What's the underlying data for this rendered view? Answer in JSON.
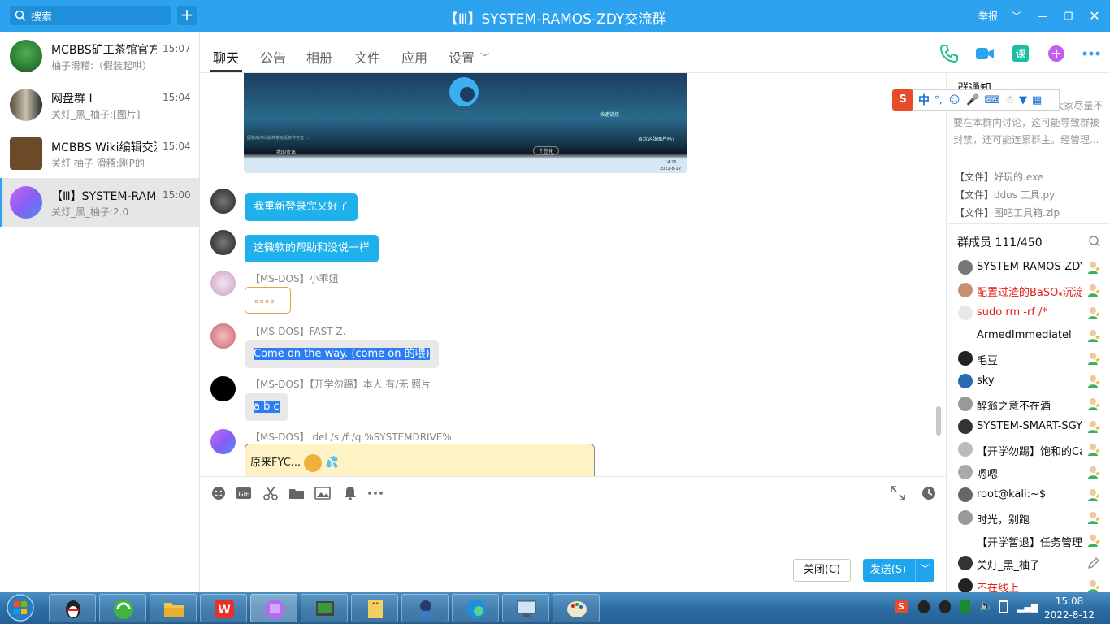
{
  "titlebar": {
    "search_label": "搜索",
    "title": "【Ⅲ】SYSTEM-RAMOS-ZDY交流群",
    "report": "举报"
  },
  "conversations": [
    {
      "name": "MCBBS矿工茶馆官方",
      "time": "15:07",
      "preview": "柚子滑稽:（假装起哄）"
    },
    {
      "name": "网盘群 I",
      "time": "15:04",
      "preview": "关灯_黑_柚子:[图片]"
    },
    {
      "name": "MCBBS Wiki编辑交流",
      "time": "15:04",
      "preview": "关灯 柚子 滑稽:刚P的"
    },
    {
      "name": "【Ⅲ】SYSTEM-RAMOS",
      "time": "15:00",
      "preview": "关灯_黑_柚子:2.0"
    }
  ],
  "tabs": [
    "聊天",
    "公告",
    "相册",
    "文件",
    "应用",
    "设置"
  ],
  "messages": {
    "m1": "我重新登录完又好了",
    "m2": "这微软的帮助和没说一样",
    "m3_sender": "【MS-DOS】小乖妞",
    "m3": "。。。。",
    "m4_sender": "【MS-DOS】FAST Z.",
    "m4": "Come on the way. (come on 的喂)",
    "m5_sender": "【MS-DOS】【开学勿踢】本人 有/无 照片",
    "m5": "a b c",
    "m6_sender": "【MS-DOS】 del /s /f /q %SYSTEMDRIVE%",
    "m6": "原来FYC..."
  },
  "screenshot": {
    "link_text": "快速链接",
    "feed_text": "我的资讯",
    "personalize": "个性化",
    "like_text": "喜欢这张图片吗?",
    "footer_text": "图像由你出版并享有版权许可证 ...",
    "clock": "14:26",
    "date": "2022-8-12"
  },
  "input": {
    "close": "关闭(C)",
    "send": "发送(S)"
  },
  "notice": {
    "title": "群通知",
    "text": "近国家 zz问题较敏感，大家尽量不要在本群内讨论，这可能导致群被封禁，还可能连累群主。经管理...",
    "files": [
      {
        "prefix": "【文件】",
        "name": "好玩的.exe"
      },
      {
        "prefix": "【文件】",
        "name": "ddos 工具.py"
      },
      {
        "prefix": "【文件】",
        "name": "图吧工具箱.zip"
      }
    ]
  },
  "members": {
    "header": "群成员 111/450",
    "list": [
      {
        "name": "SYSTEM-RAMOS-ZDY",
        "red": false
      },
      {
        "name": "配置过渣的BaSO₄沉淀",
        "red": true
      },
      {
        "name": "sudo rm -rf /*",
        "red": true
      },
      {
        "name": "ArmedImmediatel",
        "red": false
      },
      {
        "name": "毛豆",
        "red": false
      },
      {
        "name": "sky",
        "red": false
      },
      {
        "name": "醉翁之意不在酒",
        "red": false
      },
      {
        "name": "SYSTEM-SMART-SGY",
        "red": false
      },
      {
        "name": "【开学勿踢】饱和的Ca",
        "red": false
      },
      {
        "name": "嗯嗯",
        "red": false
      },
      {
        "name": "root@kali:~$",
        "red": false
      },
      {
        "name": "时光，别跑",
        "red": false
      },
      {
        "name": "【开学暂退】任务管理器",
        "red": false
      },
      {
        "name": "关灯_黑_柚子",
        "red": false
      },
      {
        "name": "不在线上",
        "red": true
      }
    ]
  },
  "ime": {
    "lang": "中",
    "punct": "°,"
  },
  "taskbar": {
    "time": "15:08",
    "date": "2022-8-12"
  },
  "colors": {
    "accent": "#2da3f0",
    "bubble_blue": "#1fb1ec",
    "red_name": "#e0201a"
  }
}
